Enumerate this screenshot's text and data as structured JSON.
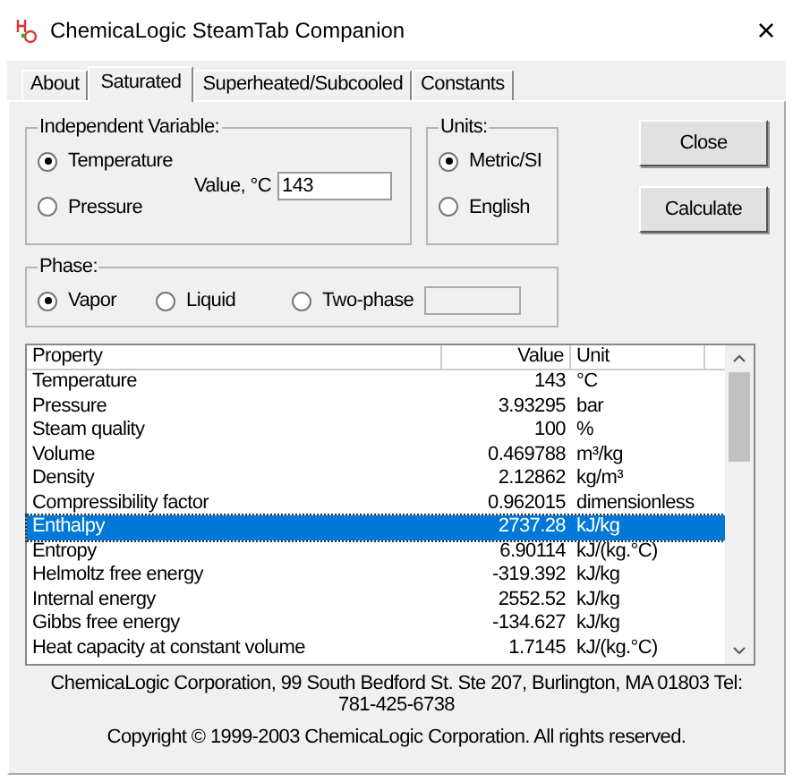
{
  "window": {
    "title": "ChemicaLogic SteamTab Companion",
    "close": "×"
  },
  "tabs": [
    {
      "label": "About",
      "selected": false
    },
    {
      "label": "Saturated",
      "selected": true
    },
    {
      "label": "Superheated/Subcooled",
      "selected": false
    },
    {
      "label": "Constants",
      "selected": false
    }
  ],
  "independent_variable": {
    "title": "Independent Variable:",
    "options": [
      {
        "label": "Temperature",
        "selected": true
      },
      {
        "label": "Pressure",
        "selected": false
      }
    ],
    "value_label": "Value, °C",
    "value": "143"
  },
  "units": {
    "title": "Units:",
    "options": [
      {
        "label": "Metric/SI",
        "selected": true
      },
      {
        "label": "English",
        "selected": false
      }
    ]
  },
  "buttons": [
    "Close",
    "Calculate"
  ],
  "phase": {
    "title": "Phase:",
    "options": [
      {
        "label": "Vapor",
        "selected": true
      },
      {
        "label": "Liquid",
        "selected": false
      },
      {
        "label": "Two-phase",
        "selected": false
      }
    ],
    "two_phase_field": {
      "disabled": true
    }
  },
  "table": {
    "columns": [
      "Property",
      "Value",
      "Unit"
    ],
    "rows": [
      {
        "property": "Temperature",
        "value": "143",
        "unit": "°C",
        "selected": false
      },
      {
        "property": "Pressure",
        "value": "3.93295",
        "unit": "bar",
        "selected": false
      },
      {
        "property": "Steam quality",
        "value": "100",
        "unit": "%",
        "selected": false
      },
      {
        "property": "Volume",
        "value": "0.469788",
        "unit": "m³/kg",
        "selected": false
      },
      {
        "property": "Density",
        "value": "2.12862",
        "unit": "kg/m³",
        "selected": false
      },
      {
        "property": "Compressibility factor",
        "value": "0.962015",
        "unit": "dimensionless",
        "selected": false
      },
      {
        "property": "Enthalpy",
        "value": "2737.28",
        "unit": "kJ/kg",
        "selected": true
      },
      {
        "property": "Entropy",
        "value": "6.90114",
        "unit": "kJ/(kg.°C)",
        "selected": false
      },
      {
        "property": "Helmoltz free energy",
        "value": "-319.392",
        "unit": "kJ/kg",
        "selected": false
      },
      {
        "property": "Internal energy",
        "value": "2552.52",
        "unit": "kJ/kg",
        "selected": false
      },
      {
        "property": "Gibbs free energy",
        "value": "-134.627",
        "unit": "kJ/kg",
        "selected": false
      },
      {
        "property": "Heat capacity at constant volume",
        "value": "1.7145",
        "unit": "kJ/(kg.°C)",
        "selected": false
      }
    ]
  },
  "footer": {
    "address": "ChemicaLogic Corporation, 99 South Bedford St. Ste 207, Burlington, MA 01803 Tel: 781-425-6738",
    "copyright": "Copyright © 1999-2003 ChemicaLogic Corporation. All rights reserved."
  }
}
